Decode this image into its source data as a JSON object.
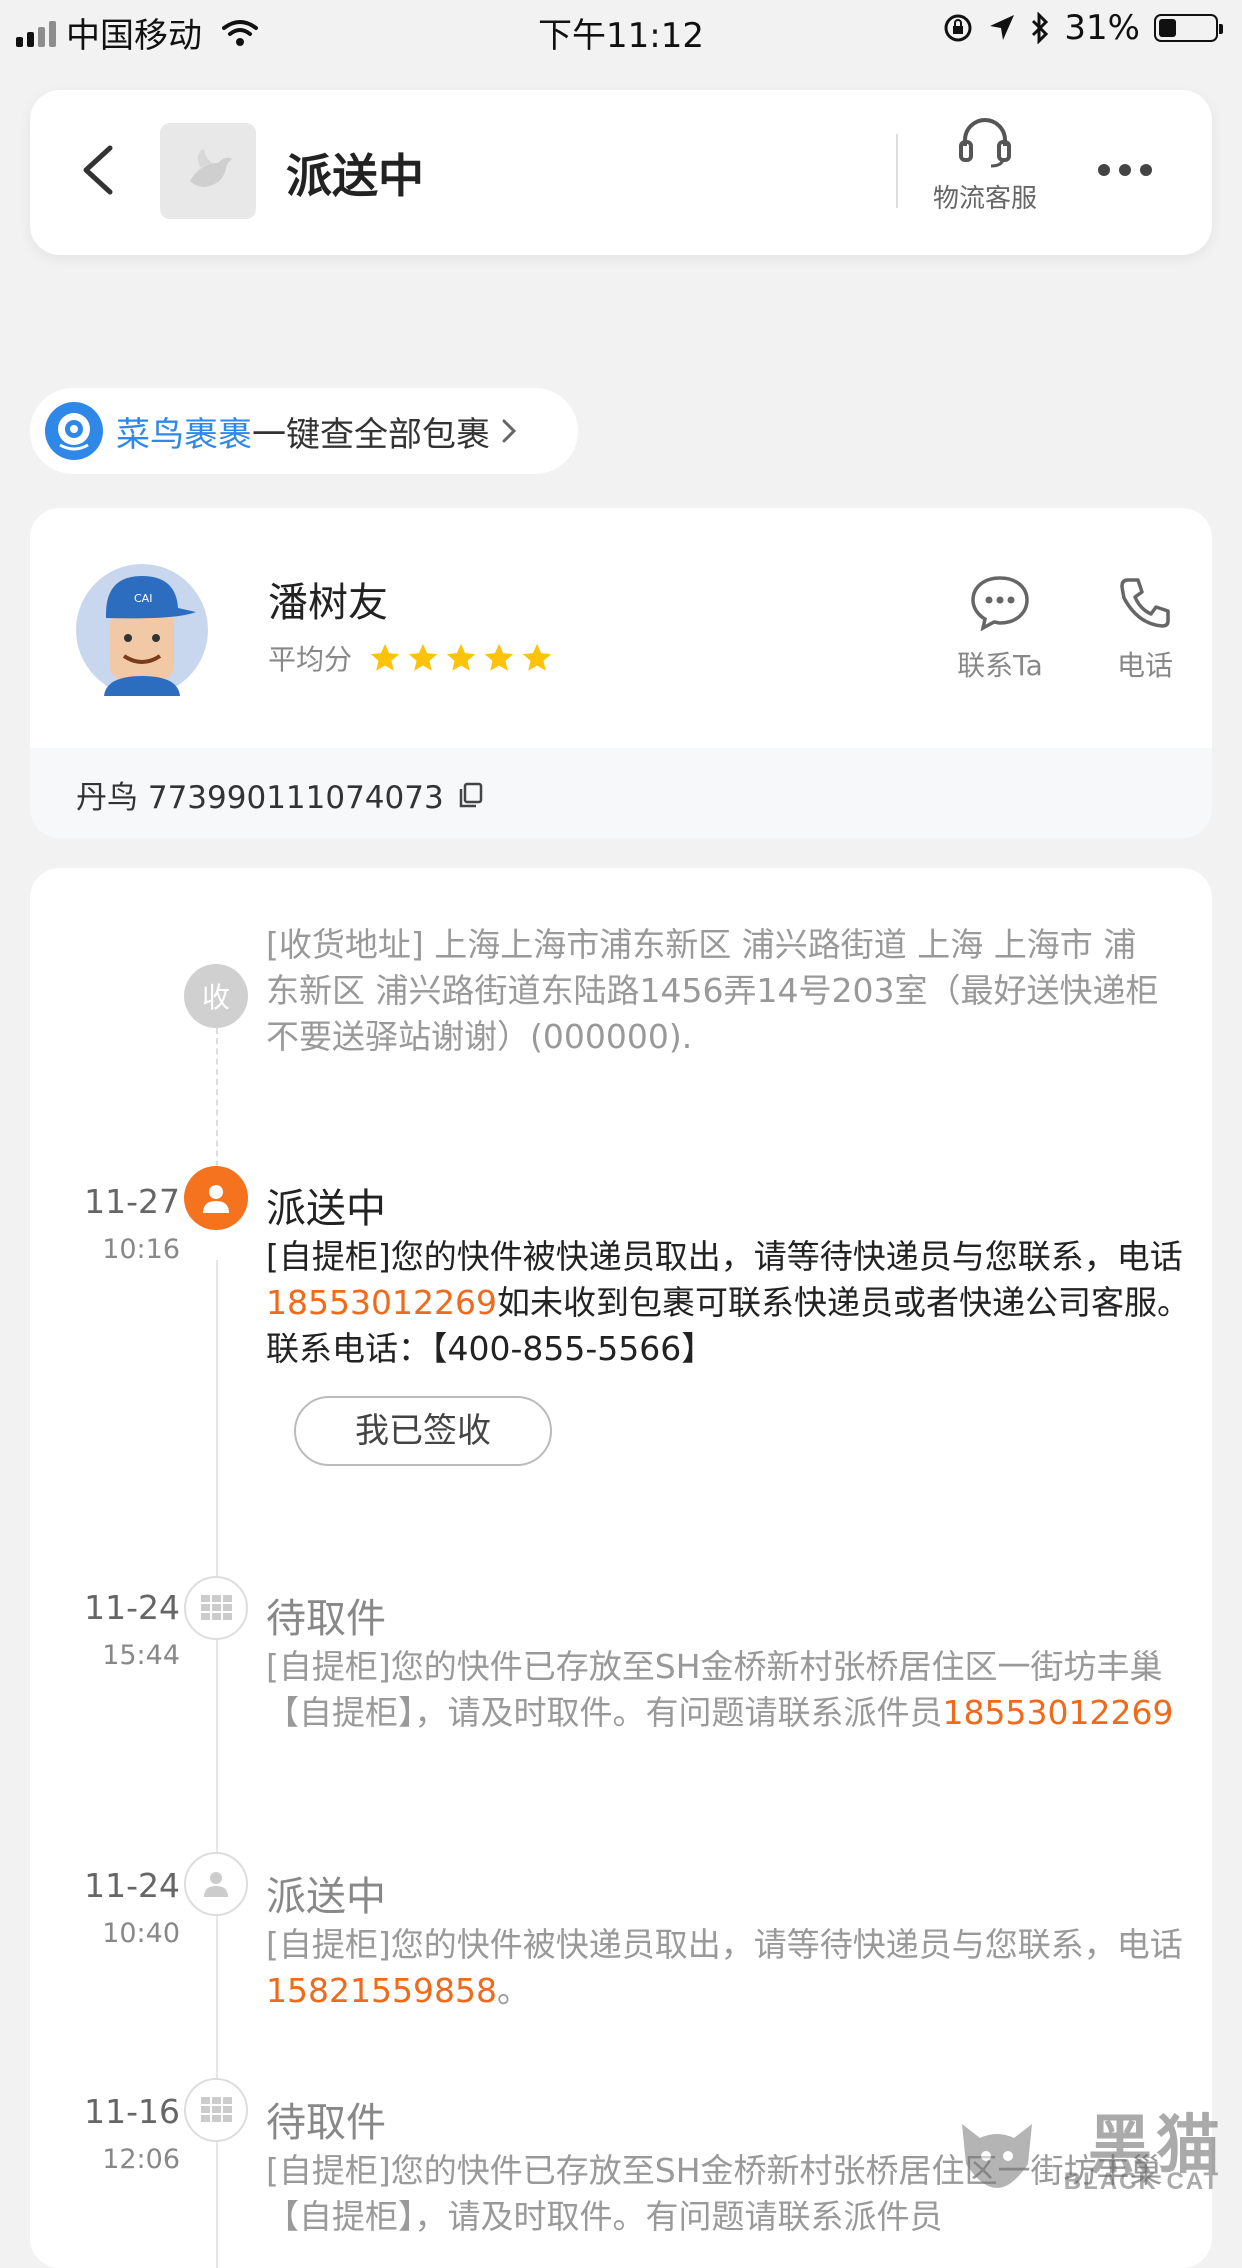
{
  "status_bar": {
    "carrier": "中国移动",
    "time": "下午11:12",
    "battery_text": "31%",
    "battery_level": 0.31
  },
  "header": {
    "title": "派送中",
    "customer_service_label": "物流客服"
  },
  "cainiao": {
    "brand": "菜鸟裹裹",
    "text": "一键查全部包裹"
  },
  "courier": {
    "name": "潘树友",
    "rating_label": "平均分",
    "stars": 5,
    "contact_label": "联系Ta",
    "phone_label": "电话",
    "tracking": "丹鸟 773990111074073"
  },
  "address": {
    "badge": "收",
    "text": "[收货地址] 上海上海市浦东新区  浦兴路街道   上海 上海市 浦东新区 浦兴路街道东陆路1456弄14号203室（最好送快递柜不要送驿站谢谢）(000000)."
  },
  "events": [
    {
      "date": "11-27",
      "time": "10:16",
      "status": "派送中",
      "desc_before": "[自提柜]您的快件被快递员取出，请等待快递员与您联系，电话",
      "phone": "18553012269",
      "desc_after": "如未收到包裹可联系快递员或者快递公司客服。联系电话：【400-855-5566】",
      "button": "我已签收"
    },
    {
      "date": "11-24",
      "time": "15:44",
      "status": "待取件",
      "desc_before": "[自提柜]您的快件已存放至SH金桥新村张桥居住区一街坊丰巢【自提柜】，请及时取件。有问题请联系派件员",
      "phone": "18553012269",
      "desc_after": ""
    },
    {
      "date": "11-24",
      "time": "10:40",
      "status": "派送中",
      "desc_before": "[自提柜]您的快件被快递员取出，请等待快递员与您联系，电话",
      "phone": "15821559858",
      "desc_after": "。"
    },
    {
      "date": "11-16",
      "time": "12:06",
      "status": "待取件",
      "desc_before": "[自提柜]您的快件已存放至SH金桥新村张桥居住区一街坊丰巢【自提柜】，请及时取件。有问题请联系派件员",
      "phone": "",
      "desc_after": ""
    }
  ],
  "watermark": {
    "big": "黑猫",
    "small": "BLACK CAT"
  },
  "colors": {
    "accent_orange": "#f5731f",
    "phone_orange": "#f06a1b",
    "cainiao_blue": "#2f88e8",
    "star_yellow": "#fcc30a"
  },
  "icons": [
    "back-icon",
    "logo-icon",
    "headset-icon",
    "more-icon",
    "cainiao-icon",
    "chevron-right-icon",
    "avatar",
    "chat-icon",
    "phone-icon",
    "copy-icon",
    "person-icon",
    "locker-icon"
  ]
}
